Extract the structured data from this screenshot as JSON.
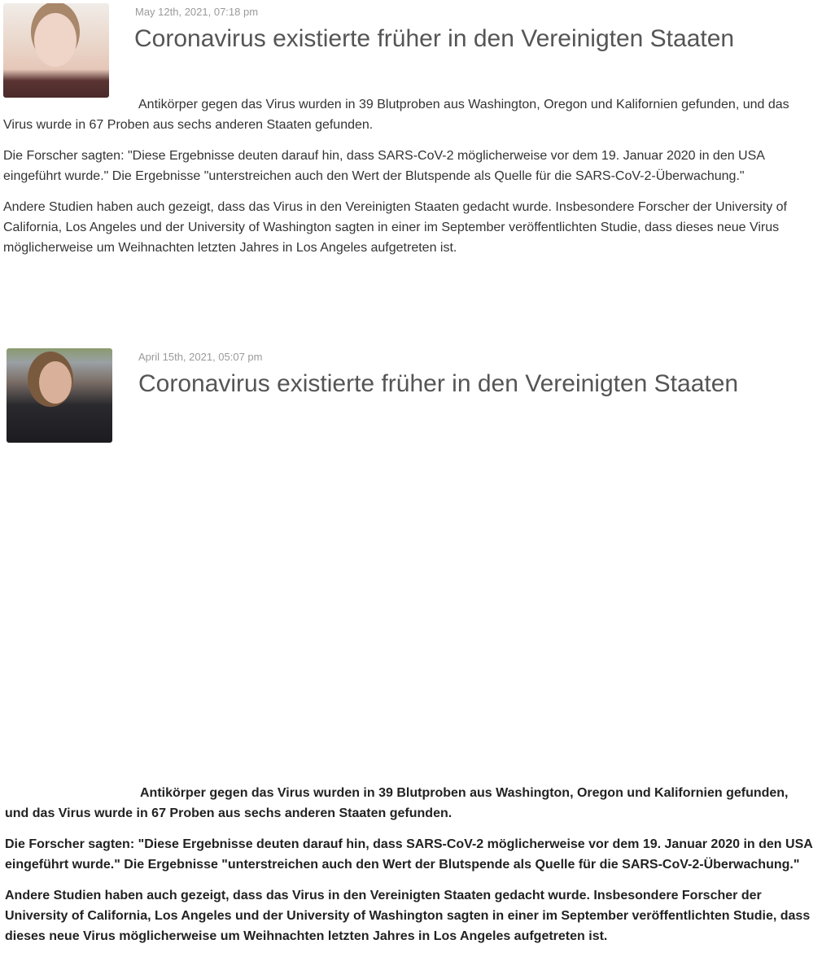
{
  "posts": [
    {
      "date": "May 12th, 2021, 07:18 pm",
      "title": "Coronavirus existierte früher in den Vereinigten Staaten",
      "paragraphs": [
        "Antikörper gegen das Virus wurden in 39 Blutproben aus Washington, Oregon und Kalifornien gefunden, und das Virus wurde in 67 Proben aus sechs anderen Staaten gefunden.",
        "Die Forscher sagten: \"Diese Ergebnisse deuten darauf hin, dass SARS-CoV-2 möglicherweise vor dem 19. Januar 2020 in den USA eingeführt wurde.\" Die Ergebnisse \"unterstreichen auch den Wert der Blutspende als Quelle für die SARS-CoV-2-Überwachung.\"",
        "Andere Studien haben auch gezeigt, dass das Virus in den Vereinigten Staaten gedacht wurde. Insbesondere Forscher der University of California, Los Angeles und der University of Washington sagten in einer im September veröffentlichten Studie, dass dieses neue Virus möglicherweise um Weihnachten letzten Jahres in Los Angeles aufgetreten ist."
      ]
    },
    {
      "date": "April 15th, 2021, 05:07 pm",
      "title": "Coronavirus existierte früher in den Vereinigten Staaten",
      "paragraphs": [
        "Antikörper gegen das Virus wurden in 39 Blutproben aus Washington, Oregon und Kalifornien gefunden, und das Virus wurde in 67 Proben aus sechs anderen Staaten gefunden.",
        "Die Forscher sagten: \"Diese Ergebnisse deuten darauf hin, dass SARS-CoV-2 möglicherweise vor dem 19. Januar 2020 in den USA eingeführt wurde.\" Die Ergebnisse \"unterstreichen auch den Wert der Blutspende als Quelle für die SARS-CoV-2-Überwachung.\"",
        "Andere Studien haben auch gezeigt, dass das Virus in den Vereinigten Staaten gedacht wurde. Insbesondere Forscher der University of California, Los Angeles und der University of Washington sagten in einer im September veröffentlichten Studie, dass dieses neue Virus möglicherweise um Weihnachten letzten Jahres in Los Angeles aufgetreten ist."
      ]
    }
  ]
}
